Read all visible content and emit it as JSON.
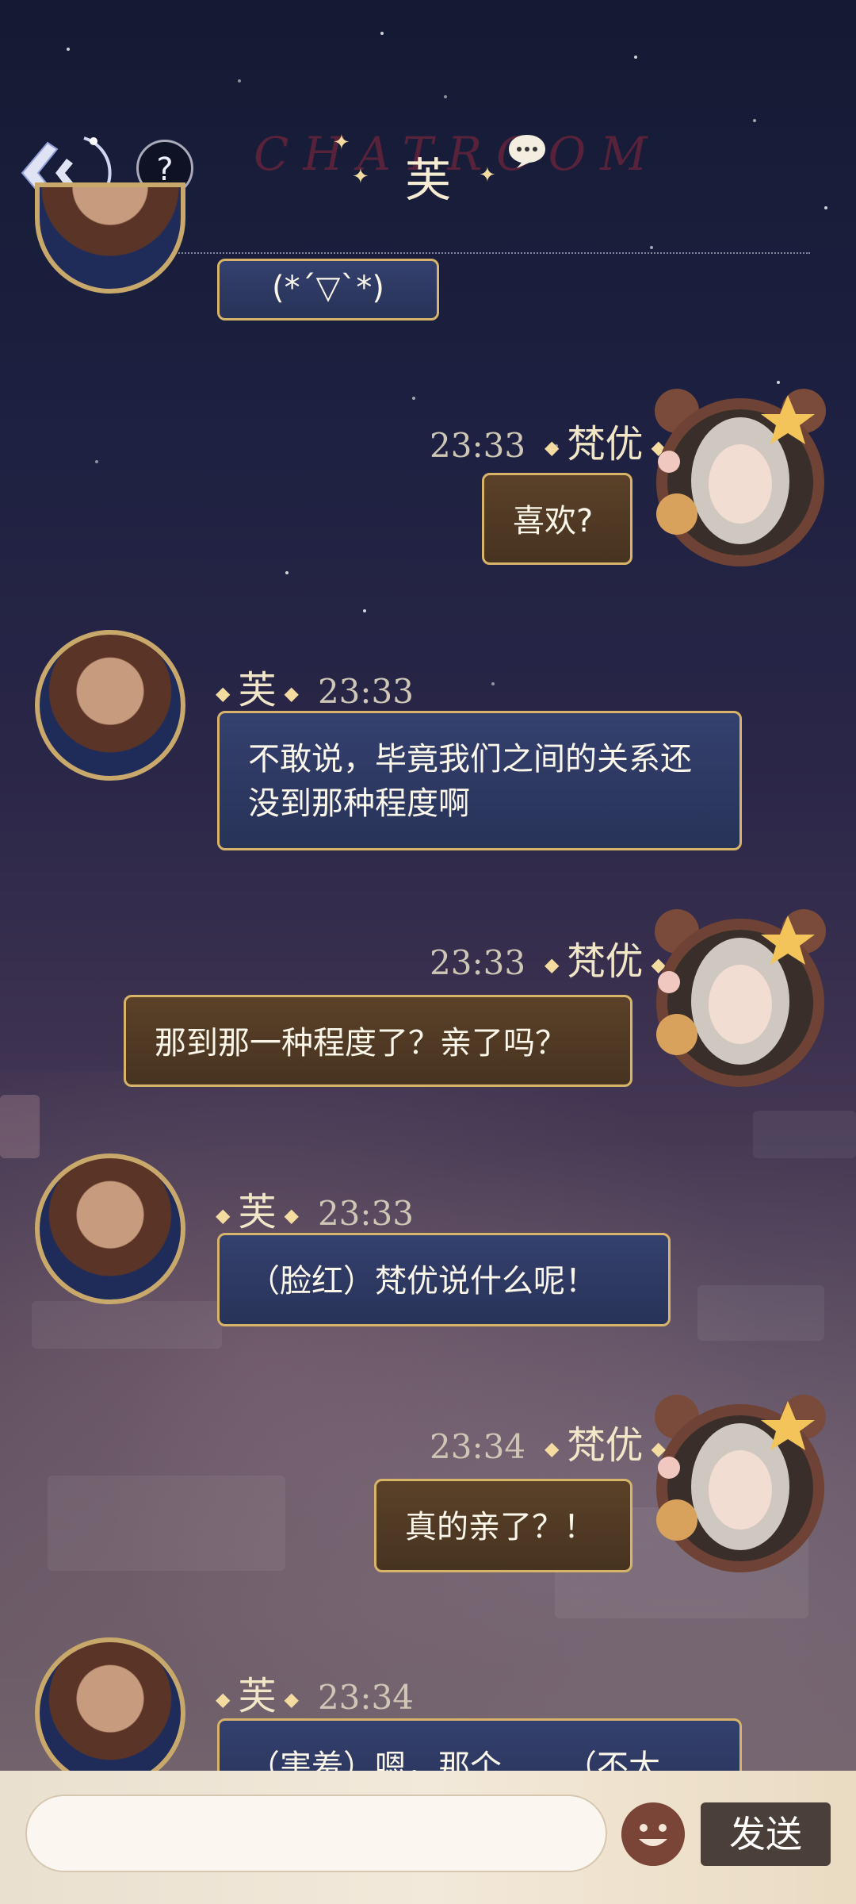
{
  "header": {
    "title": "芙",
    "watermark": "CHATROOM",
    "help_label": "?"
  },
  "input": {
    "placeholder": "",
    "send_label": "发送"
  },
  "messages": [
    {
      "side": "left",
      "name": "",
      "time": "",
      "text": "(*´▽`*)"
    },
    {
      "side": "right",
      "name": "梵优",
      "time": "23:33",
      "text": "喜欢?"
    },
    {
      "side": "left",
      "name": "芙",
      "time": "23:33",
      "text": "不敢说，毕竟我们之间的关系还没到那种程度啊"
    },
    {
      "side": "right",
      "name": "梵优",
      "time": "23:33",
      "text": "那到那一种程度了？亲了吗？"
    },
    {
      "side": "left",
      "name": "芙",
      "time": "23:33",
      "text": "（脸红）梵优说什么呢！"
    },
    {
      "side": "right",
      "name": "梵优",
      "time": "23:34",
      "text": "真的亲了？！"
    },
    {
      "side": "left",
      "name": "芙",
      "time": "23:34",
      "text": "（害羞）嗯，那个……（不大"
    }
  ],
  "colors": {
    "bubble_border": "#d8b46a",
    "bubble_blue": "#2f3a64",
    "bubble_brown": "#513a24"
  }
}
